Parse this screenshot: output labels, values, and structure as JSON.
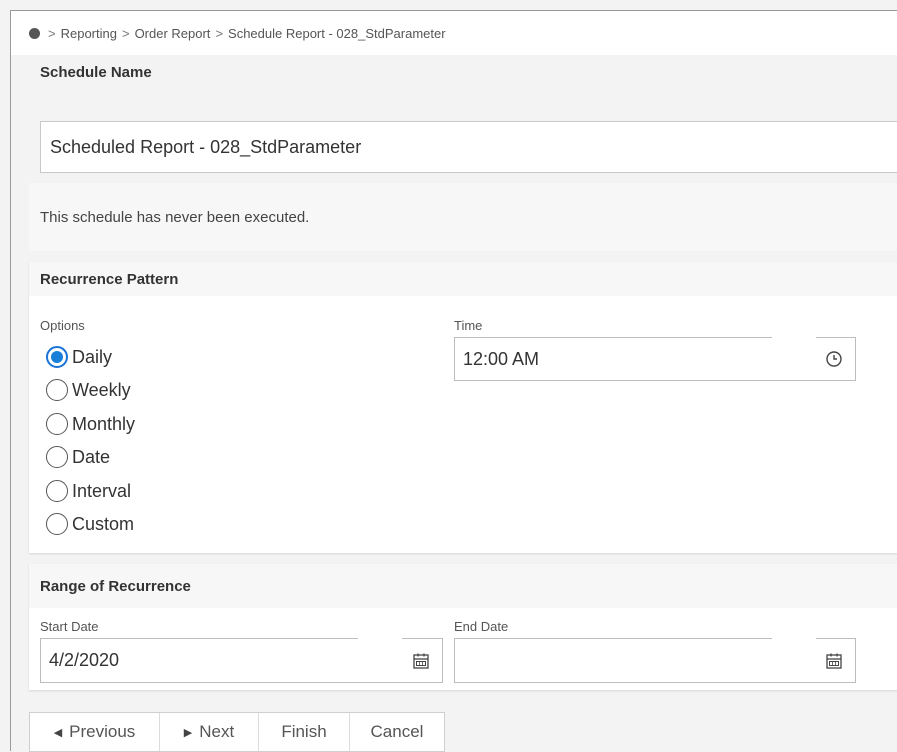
{
  "breadcrumb": {
    "items": [
      "Reporting",
      "Order Report",
      "Schedule Report - 028_StdParameter"
    ]
  },
  "schedule_name": {
    "header": "Schedule Name",
    "value": "Scheduled Report - 028_StdParameter"
  },
  "status": {
    "message": "This schedule has never been executed."
  },
  "recurrence": {
    "header": "Recurrence Pattern",
    "options_label": "Options",
    "options": [
      "Daily",
      "Weekly",
      "Monthly",
      "Date",
      "Interval",
      "Custom"
    ],
    "selected": "Daily",
    "time_label": "Time",
    "time_value": "12:00 AM",
    "accent_color": "#1a7fd8"
  },
  "range": {
    "header": "Range of Recurrence",
    "start_label": "Start Date",
    "start_value": "4/2/2020",
    "end_label": "End Date",
    "end_value": ""
  },
  "buttons": {
    "previous": "Previous",
    "next": "Next",
    "finish": "Finish",
    "cancel": "Cancel"
  },
  "icons": {
    "time": "clock-icon",
    "date": "calendar-icon",
    "home": "home-dot-icon"
  }
}
